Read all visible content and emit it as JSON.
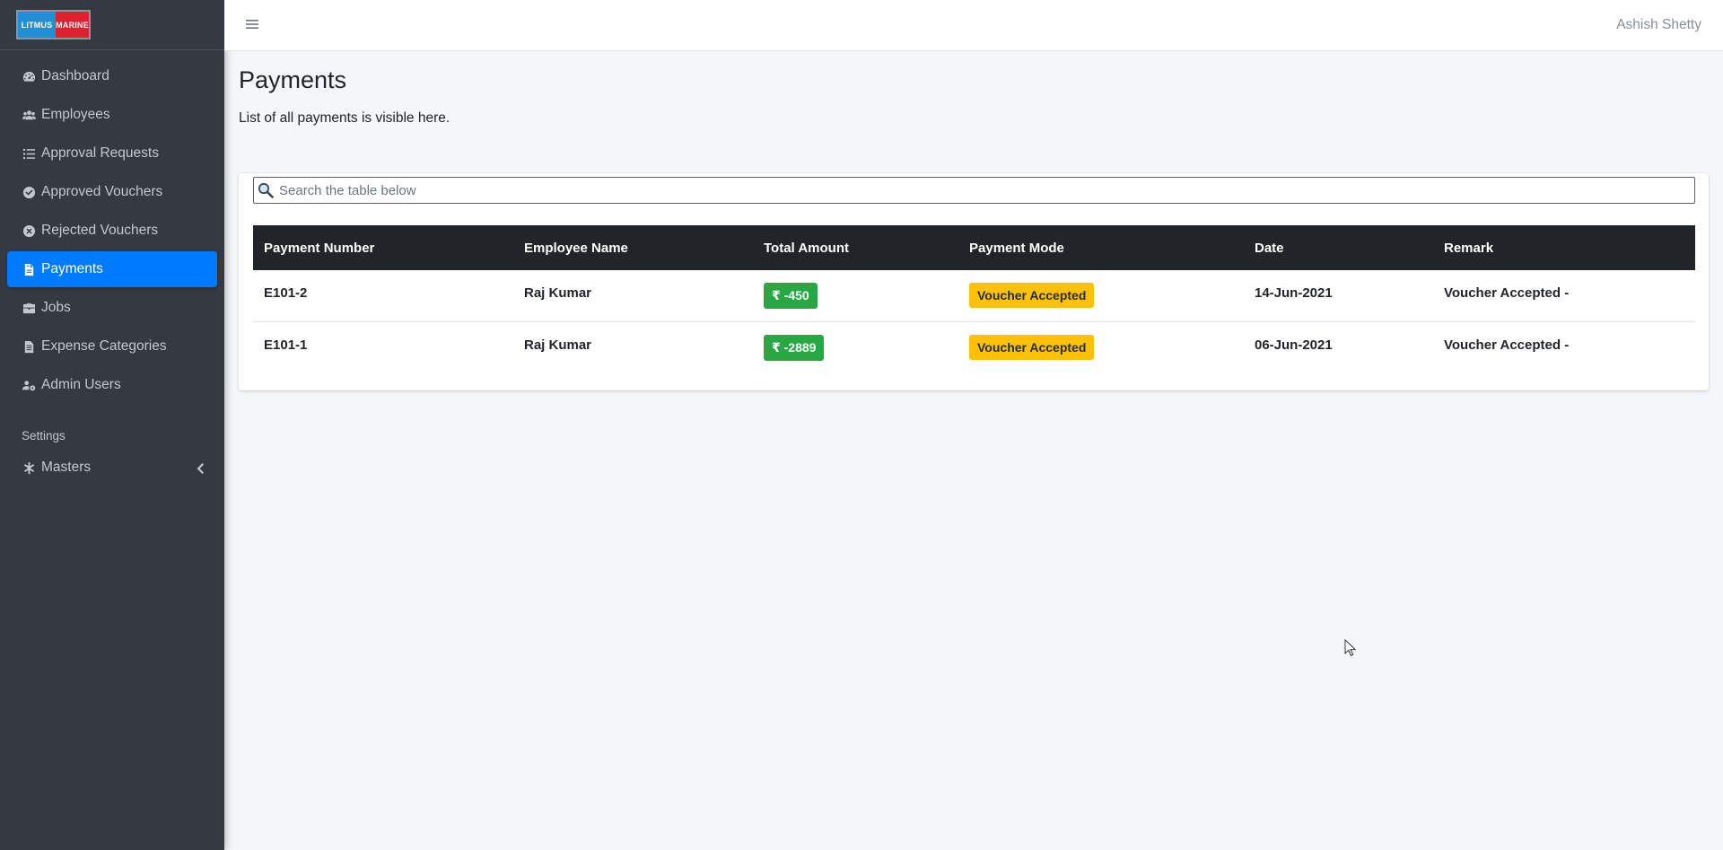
{
  "brand": {
    "logo_left": "LITMUS",
    "logo_right": "MARINE"
  },
  "sidebar": {
    "items": [
      {
        "label": "Dashboard",
        "icon": "dashboard-icon"
      },
      {
        "label": "Employees",
        "icon": "users-icon"
      },
      {
        "label": "Approval Requests",
        "icon": "list-icon"
      },
      {
        "label": "Approved Vouchers",
        "icon": "check-circle-icon"
      },
      {
        "label": "Rejected Vouchers",
        "icon": "times-circle-icon"
      },
      {
        "label": "Payments",
        "icon": "file-invoice-icon",
        "active": true
      },
      {
        "label": "Jobs",
        "icon": "briefcase-icon"
      },
      {
        "label": "Expense Categories",
        "icon": "file-alt-icon"
      },
      {
        "label": "Admin Users",
        "icon": "users-cog-icon"
      }
    ],
    "settings_header": "Settings",
    "masters": {
      "label": "Masters",
      "icon": "asterisk-icon"
    }
  },
  "topbar": {
    "user_name": "Ashish Shetty"
  },
  "page": {
    "title": "Payments",
    "description": "List of all payments is visible here."
  },
  "search": {
    "placeholder": "Search the table below",
    "value": ""
  },
  "table": {
    "headers": [
      "Payment Number",
      "Employee Name",
      "Total Amount",
      "Payment Mode",
      "Date",
      "Remark"
    ],
    "rows": [
      {
        "payment_number": "E101-2",
        "employee_name": "Raj Kumar",
        "total_amount": "₹ -450",
        "payment_mode": "Voucher Accepted",
        "date": "14-Jun-2021",
        "remark": "Voucher Accepted -"
      },
      {
        "payment_number": "E101-1",
        "employee_name": "Raj Kumar",
        "total_amount": "₹ -2889",
        "payment_mode": "Voucher Accepted",
        "date": "06-Jun-2021",
        "remark": "Voucher Accepted -"
      }
    ]
  },
  "colors": {
    "sidebar_bg": "#343a40",
    "active_item": "#007bff",
    "amount_badge": "#28a745",
    "mode_badge": "#ffc107",
    "table_header": "#212529"
  }
}
